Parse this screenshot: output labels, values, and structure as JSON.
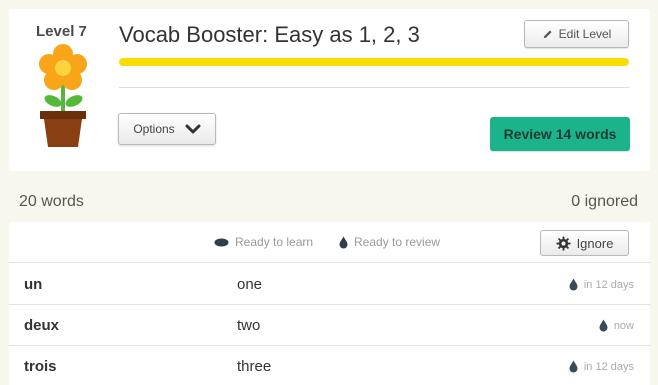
{
  "level": {
    "label": "Level 7",
    "title": "Vocab Booster: Easy as 1, 2, 3",
    "edit_label": "Edit Level",
    "progress": 1.0,
    "options_label": "Options",
    "review_label": "Review 14 words"
  },
  "summary": {
    "word_count": "20 words",
    "ignored_count": "0 ignored"
  },
  "legend": {
    "ready_to_learn": "Ready to learn",
    "ready_to_review": "Ready to review",
    "ignore_label": "Ignore"
  },
  "words": [
    {
      "term": "un",
      "definition": "one",
      "due": "in 12 days"
    },
    {
      "term": "deux",
      "definition": "two",
      "due": "now"
    },
    {
      "term": "trois",
      "definition": "three",
      "due": "in 12 days"
    }
  ],
  "colors": {
    "background": "#f8f7ed",
    "progress": "#f9dc00",
    "review_button": "#1bb38a",
    "flower_petal": "#f8a51a",
    "pot": "#8a3f12",
    "leaf": "#55b83a"
  },
  "icons": {
    "level_badge": "potted-flower-icon",
    "edit": "pencil-icon",
    "options": "chevron-down-icon",
    "ready_to_learn": "seed-icon",
    "ready_to_review": "water-drop-icon",
    "ignore": "gear-icon"
  }
}
